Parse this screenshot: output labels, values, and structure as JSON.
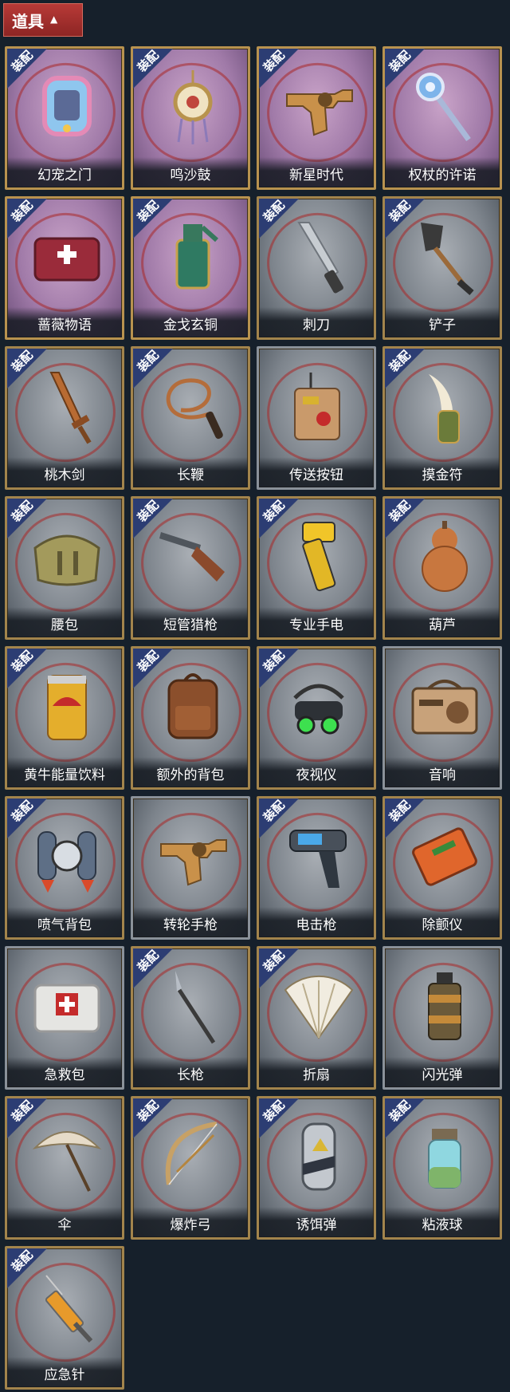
{
  "header": {
    "title": "道具",
    "toggle_icon": "chevron-up-icon"
  },
  "badge_text": "装配",
  "items": [
    {
      "name": "幻宠之门",
      "equipped": true,
      "theme": "purple",
      "icon": "pet-tablet-icon"
    },
    {
      "name": "鸣沙鼓",
      "equipped": true,
      "theme": "purple",
      "icon": "drum-pendant-icon"
    },
    {
      "name": "新星时代",
      "equipped": true,
      "theme": "purple",
      "icon": "revolver-icon"
    },
    {
      "name": "权杖的许诺",
      "equipped": true,
      "theme": "purple",
      "icon": "scepter-icon"
    },
    {
      "name": "蔷薇物语",
      "equipped": true,
      "theme": "purple",
      "icon": "medkit-icon"
    },
    {
      "name": "金戈玄铜",
      "equipped": true,
      "theme": "purple",
      "icon": "grenade-icon"
    },
    {
      "name": "刺刀",
      "equipped": true,
      "theme": "gray",
      "icon": "bayonet-icon"
    },
    {
      "name": "铲子",
      "equipped": true,
      "theme": "gray",
      "icon": "shovel-icon"
    },
    {
      "name": "桃木剑",
      "equipped": true,
      "theme": "gray",
      "icon": "wooden-sword-icon"
    },
    {
      "name": "长鞭",
      "equipped": true,
      "theme": "gray",
      "icon": "whip-icon"
    },
    {
      "name": "传送按钮",
      "equipped": false,
      "theme": "gray",
      "icon": "remote-button-icon"
    },
    {
      "name": "摸金符",
      "equipped": true,
      "theme": "gray",
      "icon": "tooth-amulet-icon"
    },
    {
      "name": "腰包",
      "equipped": true,
      "theme": "gray",
      "icon": "waist-bag-icon"
    },
    {
      "name": "短管猎枪",
      "equipped": true,
      "theme": "gray",
      "icon": "shotgun-icon"
    },
    {
      "name": "专业手电",
      "equipped": true,
      "theme": "gray",
      "icon": "flashlight-icon"
    },
    {
      "name": "葫芦",
      "equipped": true,
      "theme": "gray",
      "icon": "gourd-icon"
    },
    {
      "name": "黄牛能量饮料",
      "equipped": true,
      "theme": "gray",
      "icon": "energy-drink-icon"
    },
    {
      "name": "额外的背包",
      "equipped": true,
      "theme": "gray",
      "icon": "backpack-icon"
    },
    {
      "name": "夜视仪",
      "equipped": true,
      "theme": "gray",
      "icon": "night-vision-icon"
    },
    {
      "name": "音响",
      "equipped": false,
      "theme": "gray",
      "icon": "boombox-icon"
    },
    {
      "name": "喷气背包",
      "equipped": true,
      "theme": "gray",
      "icon": "jetpack-icon"
    },
    {
      "name": "转轮手枪",
      "equipped": false,
      "theme": "gray",
      "icon": "revolver-icon"
    },
    {
      "name": "电击枪",
      "equipped": true,
      "theme": "gray",
      "icon": "stun-gun-icon"
    },
    {
      "name": "除颤仪",
      "equipped": true,
      "theme": "gray",
      "icon": "defibrillator-icon"
    },
    {
      "name": "急救包",
      "equipped": false,
      "theme": "gray",
      "icon": "first-aid-kit-icon"
    },
    {
      "name": "长枪",
      "equipped": true,
      "theme": "gray",
      "icon": "spear-icon"
    },
    {
      "name": "折扇",
      "equipped": true,
      "theme": "gray",
      "icon": "folding-fan-icon"
    },
    {
      "name": "闪光弹",
      "equipped": false,
      "theme": "gray",
      "icon": "flashbang-icon"
    },
    {
      "name": "伞",
      "equipped": true,
      "theme": "gray",
      "icon": "umbrella-icon"
    },
    {
      "name": "爆炸弓",
      "equipped": true,
      "theme": "gray",
      "icon": "bow-icon"
    },
    {
      "name": "诱饵弹",
      "equipped": true,
      "theme": "gray",
      "icon": "decoy-canister-icon"
    },
    {
      "name": "粘液球",
      "equipped": true,
      "theme": "gray",
      "icon": "slime-jar-icon"
    },
    {
      "name": "应急针",
      "equipped": true,
      "theme": "gray",
      "icon": "syringe-icon"
    }
  ]
}
